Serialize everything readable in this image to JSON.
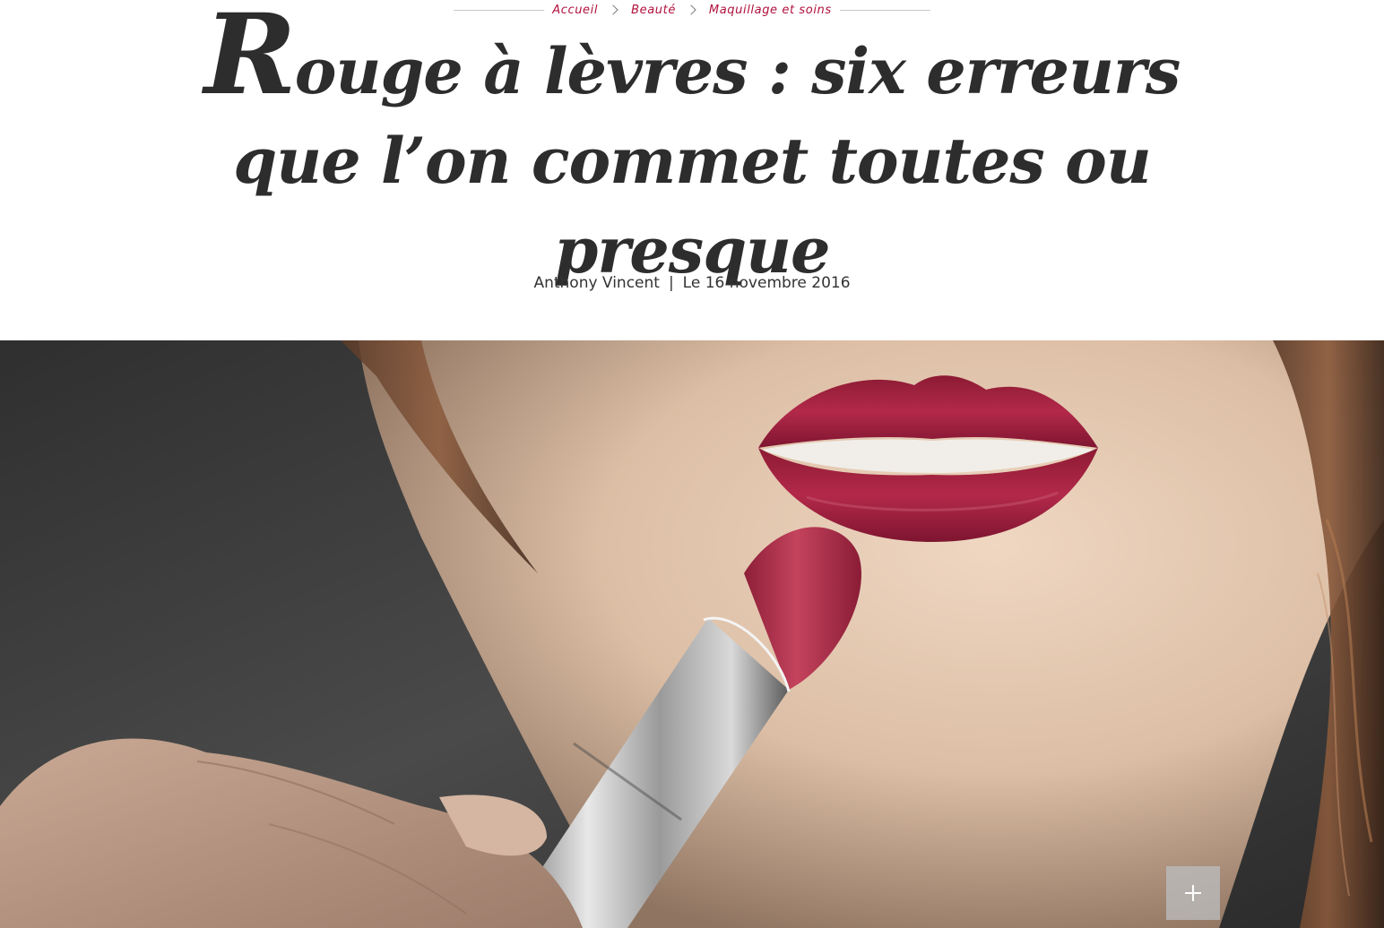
{
  "breadcrumb": {
    "items": [
      {
        "label": "Accueil"
      },
      {
        "label": "Beauté"
      },
      {
        "label": "Maquillage et soins"
      }
    ]
  },
  "article": {
    "title_dropcap": "R",
    "title_rest": "ouge à lèvres : six erreurs que l’on commet toutes ou presque",
    "author": "Anthony Vincent",
    "separator": "|",
    "date": "Le 16 novembre 2016"
  },
  "hero": {
    "subject": "lipstick-portrait-photo",
    "expand_icon": "plus-icon"
  },
  "colors": {
    "accent": "#b0103c",
    "text": "#2d2d2d",
    "lip": "#a8223f",
    "lipstick": "#b8344e",
    "background_dark": "#3a3a3a",
    "skin": "#e3c7ae"
  }
}
